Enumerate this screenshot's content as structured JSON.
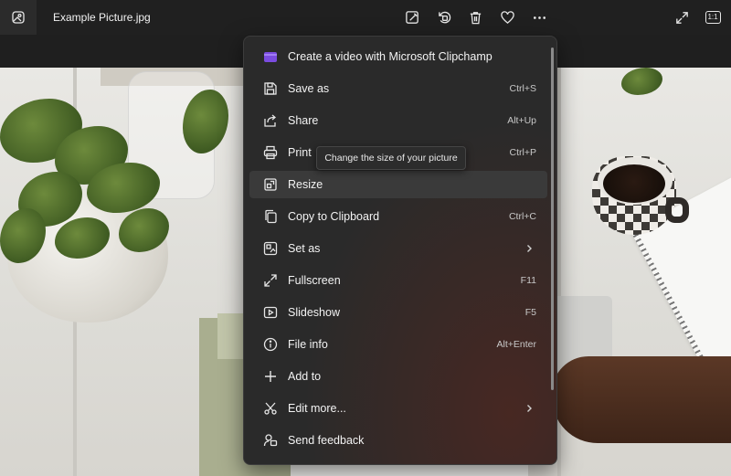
{
  "window": {
    "title": "Example Picture.jpg"
  },
  "toolbar": {
    "buttons": [
      {
        "name": "edit-image-button",
        "icon": "edit-image-icon"
      },
      {
        "name": "rotate-button",
        "icon": "rotate-icon"
      },
      {
        "name": "delete-button",
        "icon": "trash-icon"
      },
      {
        "name": "favorite-button",
        "icon": "heart-icon"
      },
      {
        "name": "more-options-button",
        "icon": "ellipsis-icon"
      }
    ],
    "right_buttons": [
      {
        "name": "expand-button",
        "icon": "expand-icon"
      },
      {
        "name": "actual-size-button",
        "icon": "actual-size-icon",
        "label": "1:1"
      }
    ]
  },
  "menu": {
    "items": [
      {
        "id": "clipchamp",
        "label": "Create a video with Microsoft Clipchamp",
        "shortcut": "",
        "icon": "clipchamp-icon"
      },
      {
        "id": "save-as",
        "label": "Save as",
        "shortcut": "Ctrl+S",
        "icon": "save-icon"
      },
      {
        "id": "share",
        "label": "Share",
        "shortcut": "Alt+Up",
        "icon": "share-icon"
      },
      {
        "id": "print",
        "label": "Print",
        "shortcut": "Ctrl+P",
        "icon": "printer-icon"
      },
      {
        "id": "resize",
        "label": "Resize",
        "shortcut": "",
        "icon": "resize-icon",
        "hovered": true
      },
      {
        "id": "copy",
        "label": "Copy to Clipboard",
        "shortcut": "Ctrl+C",
        "icon": "copy-icon"
      },
      {
        "id": "set-as",
        "label": "Set as",
        "shortcut": "",
        "icon": "set-as-icon",
        "submenu": true
      },
      {
        "id": "fullscreen",
        "label": "Fullscreen",
        "shortcut": "F11",
        "icon": "fullscreen-icon"
      },
      {
        "id": "slideshow",
        "label": "Slideshow",
        "shortcut": "F5",
        "icon": "slideshow-icon"
      },
      {
        "id": "file-info",
        "label": "File info",
        "shortcut": "Alt+Enter",
        "icon": "info-icon"
      },
      {
        "id": "add-to",
        "label": "Add to",
        "shortcut": "",
        "icon": "plus-icon"
      },
      {
        "id": "edit-more",
        "label": "Edit more...",
        "shortcut": "",
        "icon": "edit-more-icon",
        "submenu": true
      },
      {
        "id": "send-feedback",
        "label": "Send feedback",
        "shortcut": "",
        "icon": "feedback-icon"
      }
    ]
  },
  "tooltip": {
    "text": "Change the size of your picture"
  },
  "colors": {
    "menu_bg": "#2a2a2a",
    "topbar_bg": "#202020",
    "hover_bg": "#3a3a3a",
    "clipchamp_accent": "#7b4ce0"
  }
}
